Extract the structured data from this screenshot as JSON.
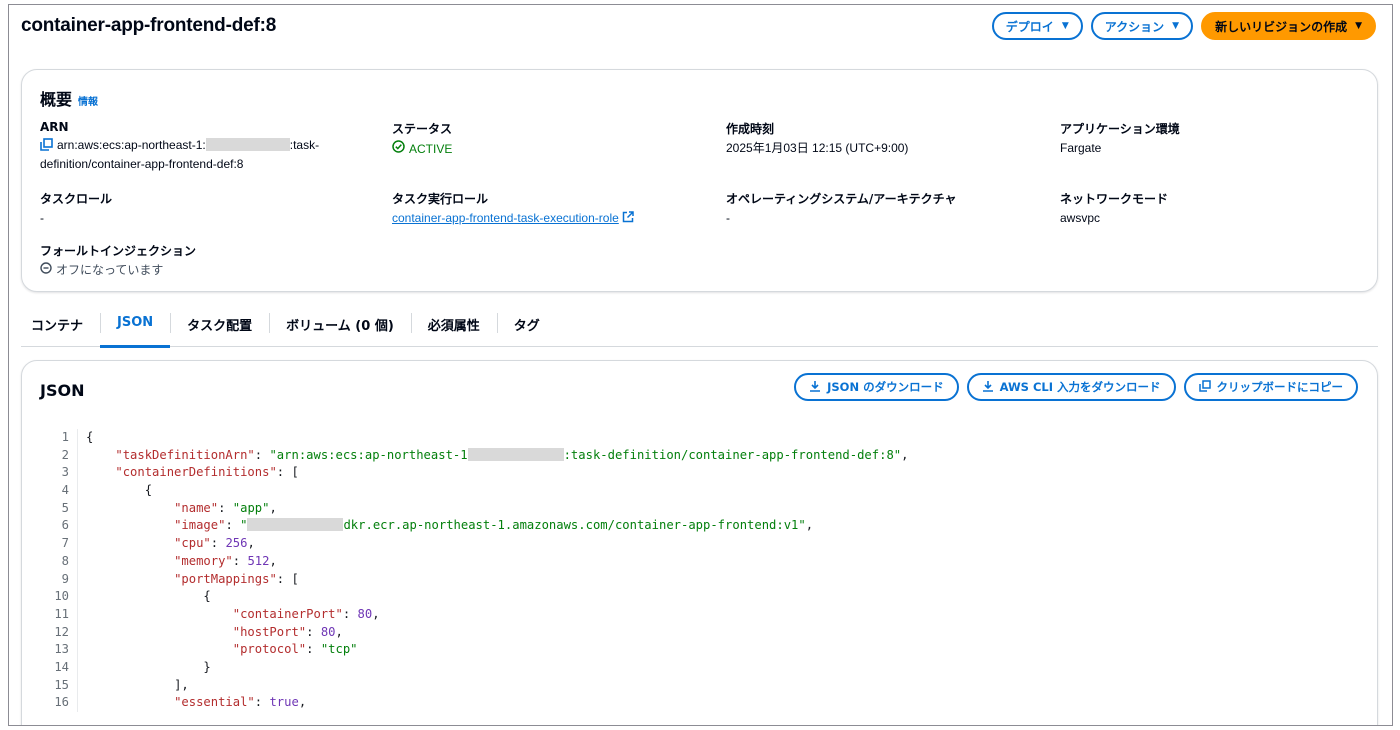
{
  "header": {
    "title": "container-app-frontend-def:8",
    "deploy_label": "デプロイ",
    "actions_label": "アクション",
    "new_revision_label": "新しいリビジョンの作成"
  },
  "overview": {
    "heading": "概要",
    "info_label": "情報",
    "arn": {
      "label": "ARN",
      "value_prefix": "arn:aws:ecs:ap-northeast-1:",
      "value_suffix": ":task-",
      "value_line2": "definition/container-app-frontend-def:8"
    },
    "status": {
      "label": "ステータス",
      "value": "ACTIVE"
    },
    "created": {
      "label": "作成時刻",
      "value": "2025年1月03日 12:15 (UTC+9:00)"
    },
    "app_env": {
      "label": "アプリケーション環境",
      "value": "Fargate"
    },
    "task_role": {
      "label": "タスクロール",
      "value": "-"
    },
    "exec_role": {
      "label": "タスク実行ロール",
      "value": "container-app-frontend-task-execution-role"
    },
    "os_arch": {
      "label": "オペレーティングシステム/アーキテクチャ",
      "value": "-"
    },
    "network_mode": {
      "label": "ネットワークモード",
      "value": "awsvpc"
    },
    "fault_injection": {
      "label": "フォールトインジェクション",
      "value": "オフになっています"
    }
  },
  "tabs": [
    "コンテナ",
    "JSON",
    "タスク配置",
    "ボリューム (0 個)",
    "必須属性",
    "タグ"
  ],
  "active_tab": "JSON",
  "json_panel": {
    "title": "JSON",
    "download_json_label": "JSON のダウンロード",
    "download_cli_label": "AWS CLI 入力をダウンロード",
    "copy_label": "クリップボードにコピー"
  },
  "code": {
    "line_numbers": [
      "1",
      "2",
      "3",
      "4",
      "5",
      "6",
      "7",
      "8",
      "9",
      "10",
      "11",
      "12",
      "13",
      "14",
      "15",
      "16"
    ],
    "l1": "{",
    "l2_key": "\"taskDefinitionArn\"",
    "l2_val_a": "\"arn:aws:ecs:ap-northeast-1",
    "l2_val_b": ":task-definition/container-app-frontend-def:8\"",
    "l3_key": "\"containerDefinitions\"",
    "l3_rest": ": [",
    "l4": "{",
    "l5_key": "\"name\"",
    "l5_val": "\"app\"",
    "l6_key": "\"image\"",
    "l6_val_a": "\"",
    "l6_val_b": "dkr.ecr.ap-northeast-1.amazonaws.com/container-app-frontend:v1\"",
    "l7_key": "\"cpu\"",
    "l7_val": "256",
    "l8_key": "\"memory\"",
    "l8_val": "512",
    "l9_key": "\"portMappings\"",
    "l9_rest": ": [",
    "l10": "{",
    "l11_key": "\"containerPort\"",
    "l11_val": "80",
    "l12_key": "\"hostPort\"",
    "l12_val": "80",
    "l13_key": "\"protocol\"",
    "l13_val": "\"tcp\"",
    "l14": "}",
    "l15": "],",
    "l16_key": "\"essential\"",
    "l16_val": "true"
  },
  "colors": {
    "accent": "#0972d3",
    "primary_button": "#ff9900",
    "success": "#037f0c"
  },
  "icons": [
    "caret-down-icon",
    "copy-icon",
    "status-ok-icon",
    "external-link-icon",
    "status-off-icon",
    "download-icon",
    "clipboard-copy-icon"
  ]
}
